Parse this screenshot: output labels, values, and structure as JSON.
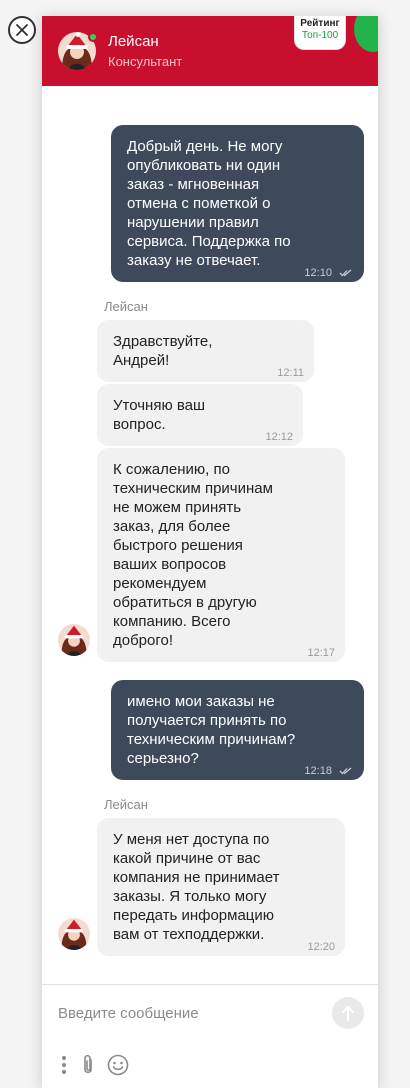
{
  "header": {
    "agent_name": "Лейсан",
    "agent_role": "Консультант",
    "rating_title": "Рейтинг",
    "rating_value": "Топ-100"
  },
  "messages": [
    {
      "direction": "out",
      "text": "Добрый день. Не могу опубликовать ни один заказ - мгновенная отмена с пометкой о нарушении правил сервиса. Поддержка по заказу не отвечает.",
      "time": "12:10"
    },
    {
      "direction": "in",
      "sender": "Лейсан",
      "text": "Здравствуйте, Андрей!",
      "time": "12:11"
    },
    {
      "direction": "in",
      "text": "Уточняю ваш вопрос.",
      "time": "12:12"
    },
    {
      "direction": "in",
      "text": "К сожалению, по техническим причинам не можем принять заказ, для более быстрого решения ваших вопросов рекомендуем обратиться в другую компанию. Всего доброго!",
      "time": "12:17"
    },
    {
      "direction": "out",
      "text": "имено мои заказы не получается принять по техническим причинам? серьезно?",
      "time": "12:18"
    },
    {
      "direction": "in",
      "sender": "Лейсан",
      "text": "У меня нет доступа по какой причине от вас компания не принимает заказы. Я только могу передать информацию вам от техподдержки.",
      "time": "12:20"
    }
  ],
  "composer": {
    "placeholder": "Введите сообщение"
  },
  "colors": {
    "header_bg": "#c8102e",
    "outgoing_bubble": "#3e4a5c",
    "incoming_bubble": "#f1f1f1",
    "online": "#39d353",
    "rating_accent": "#1a9e3a"
  },
  "icons": [
    "close-icon",
    "send-icon",
    "more-icon",
    "attach-icon",
    "emoji-icon",
    "read-check-icon"
  ]
}
